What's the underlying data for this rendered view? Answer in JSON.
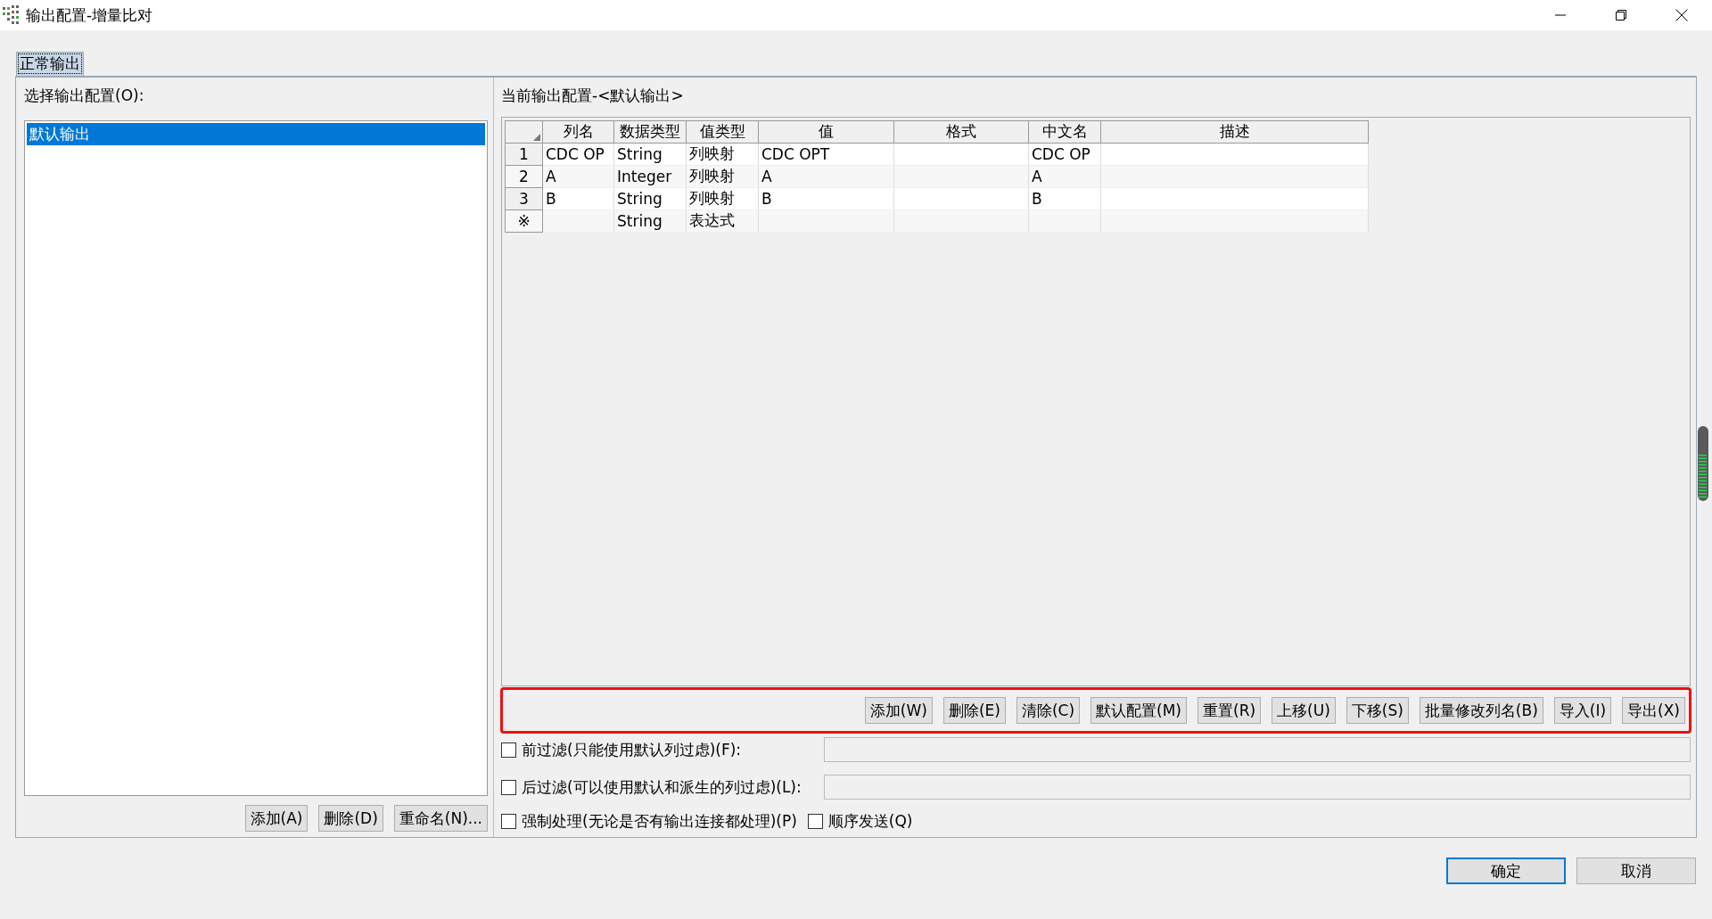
{
  "window": {
    "title": "输出配置-增量比对"
  },
  "tabs": [
    {
      "label": "正常输出",
      "selected": true
    }
  ],
  "left_panel": {
    "label": "选择输出配置(O):",
    "items": [
      {
        "label": "默认输出",
        "selected": true
      }
    ],
    "buttons": [
      "添加(A)",
      "删除(D)",
      "重命名(N)..."
    ]
  },
  "right_panel": {
    "label": "当前输出配置-<默认输出>",
    "table": {
      "columns": [
        "列名",
        "数据类型",
        "值类型",
        "值",
        "格式",
        "中文名",
        "描述"
      ],
      "rows": [
        {
          "header": "1",
          "cells": [
            "CDC OP",
            "String",
            "列映射",
            "CDC OPT",
            "",
            "CDC OP",
            ""
          ]
        },
        {
          "header": "2",
          "cells": [
            "A",
            "Integer",
            "列映射",
            "A",
            "",
            "A",
            ""
          ]
        },
        {
          "header": "3",
          "cells": [
            "B",
            "String",
            "列映射",
            "B",
            "",
            "B",
            ""
          ]
        },
        {
          "header": "※",
          "cells": [
            "",
            "String",
            "表达式",
            "",
            "",
            "",
            ""
          ]
        }
      ]
    },
    "buttons_framed": true,
    "buttons": [
      "添加(W)",
      "删除(E)",
      "清除(C)",
      "默认配置(M)",
      "重置(R)",
      "上移(U)",
      "下移(S)",
      "批量修改列名(B)",
      "导入(I)",
      "导出(X)"
    ],
    "options": [
      {
        "kind": "field",
        "label": "前过滤(只能使用默认列过虑)(F):",
        "checked": false
      },
      {
        "kind": "field",
        "label": "后过滤(可以使用默认和派生的列过虑)(L):",
        "checked": false
      },
      {
        "kind": "plain",
        "label": "强制处理(无论是否有输出连接都处理)(P)",
        "checked": false
      },
      {
        "kind": "plain",
        "label": "顺序发送(Q)",
        "checked": false
      }
    ]
  },
  "dialog_buttons": [
    {
      "label": "确定",
      "default": true
    },
    {
      "label": "取消",
      "default": false
    }
  ]
}
